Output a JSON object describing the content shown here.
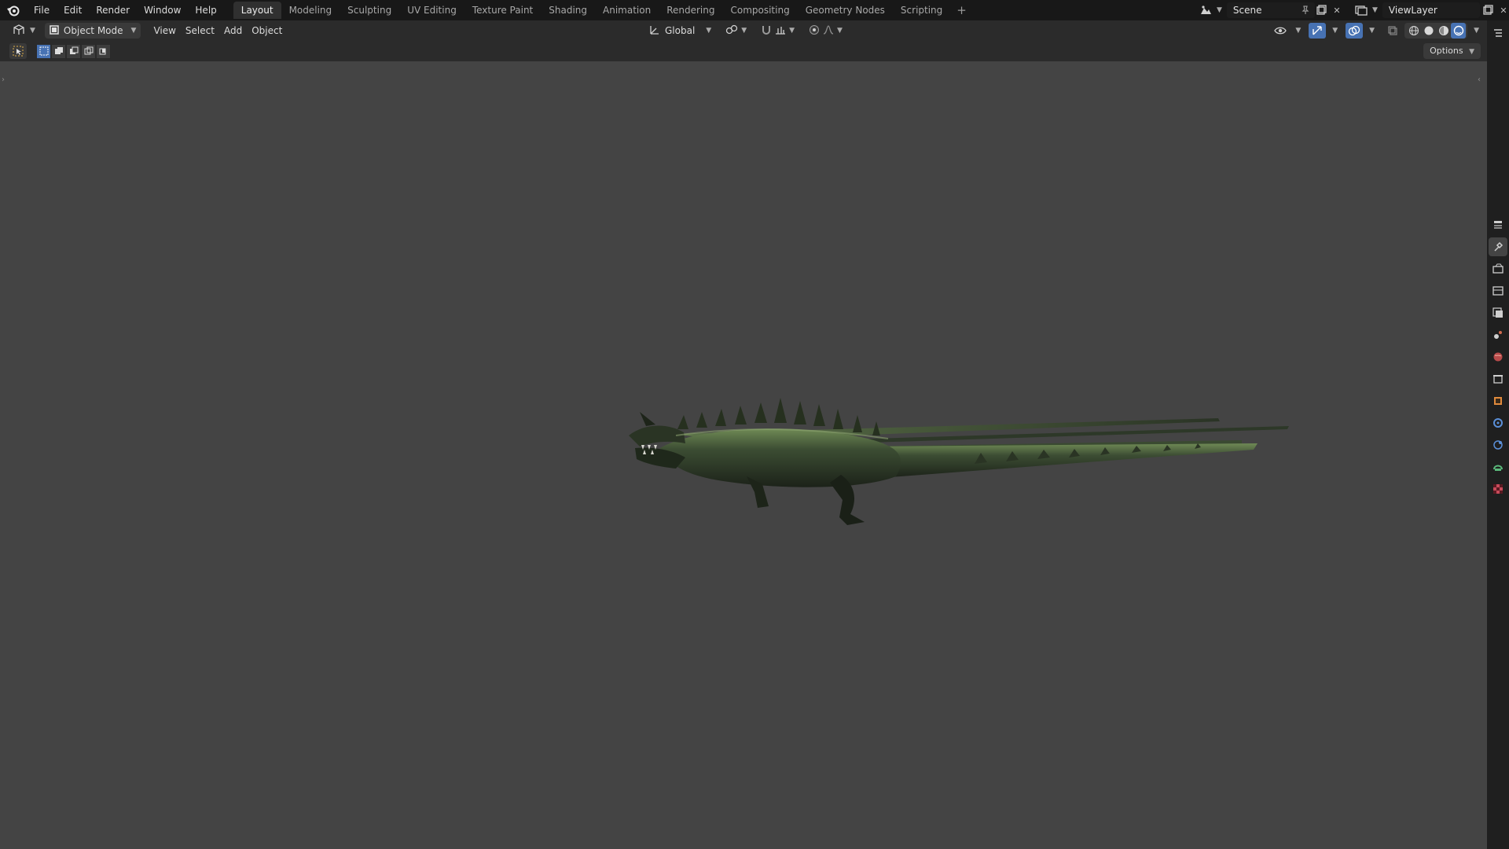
{
  "app": {
    "menu": [
      "File",
      "Edit",
      "Render",
      "Window",
      "Help"
    ],
    "workspaces": [
      "Layout",
      "Modeling",
      "Sculpting",
      "UV Editing",
      "Texture Paint",
      "Shading",
      "Animation",
      "Rendering",
      "Compositing",
      "Geometry Nodes",
      "Scripting"
    ],
    "active_workspace": "Layout",
    "add_workspace": "+",
    "scene_name": "Scene",
    "view_layer_name": "ViewLayer"
  },
  "viewport_header": {
    "mode": "Object Mode",
    "menus": [
      "View",
      "Select",
      "Add",
      "Object"
    ],
    "transform_orientation": "Global"
  },
  "tool_settings": {
    "options_label": "Options"
  },
  "colors": {
    "accent": "#4772b3",
    "viewport_bg": "#444444",
    "topbar_bg": "#181818",
    "header_bg": "#2b2b2b",
    "dragon_body": "#2f3d2a",
    "dragon_highlight": "#6f8a55"
  },
  "icons": {
    "logo": "blender-logo-icon",
    "editor_type": "3d-viewport-icon",
    "scene": "scene-icon",
    "view_layer": "view-layer-icon",
    "properties_tabs": [
      "tool-icon",
      "render-icon",
      "output-icon",
      "view-layer-props-icon",
      "scene-props-icon",
      "world-icon",
      "collection-icon",
      "object-icon",
      "modifier-icon",
      "physics-icon",
      "constraint-icon",
      "data-icon",
      "texture-icon"
    ]
  }
}
